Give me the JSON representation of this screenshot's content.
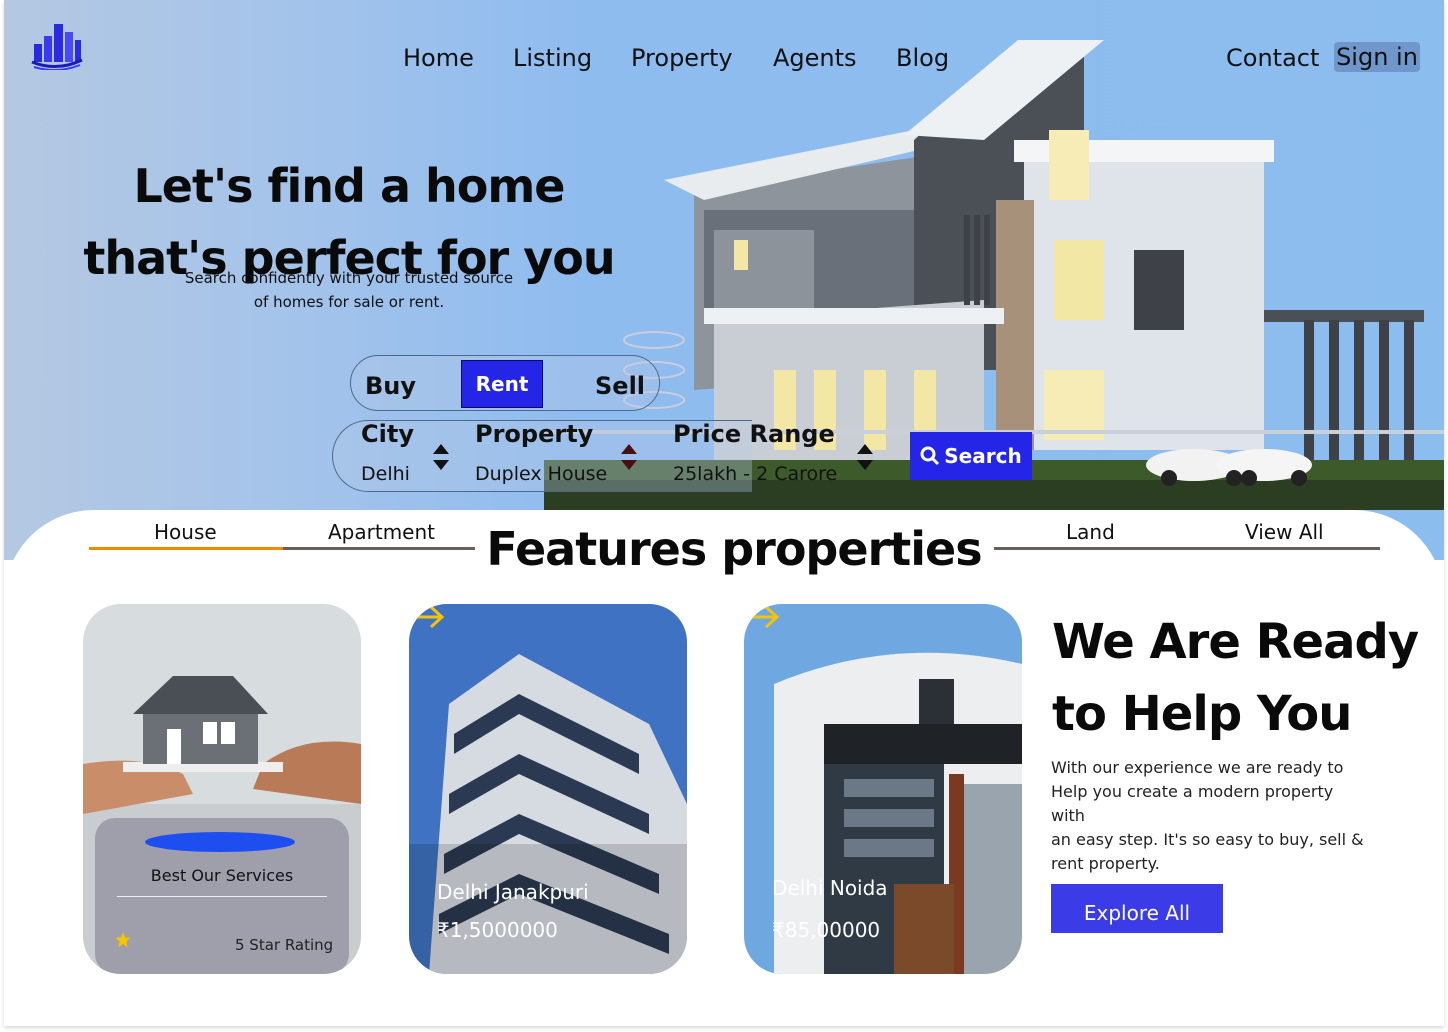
{
  "nav": {
    "items": [
      "Home",
      "Listing",
      "Property",
      "Agents",
      "Blog"
    ],
    "contact": "Contact",
    "signin": "Sign in"
  },
  "hero": {
    "headline_line1": "Let's find a home",
    "headline_line2": "that's perfect for you",
    "sub_line1": "Search confidently with your trusted source",
    "sub_line2": "of homes for sale or rent."
  },
  "search": {
    "tabs": {
      "buy": "Buy",
      "rent": "Rent",
      "sell": "Sell",
      "active": "Rent"
    },
    "city_label": "City",
    "city_value": "Delhi",
    "property_label": "Property",
    "property_value": "Duplex House",
    "price_label": "Price Range",
    "price_value": "25lakh - 2 Carore",
    "button": "Search"
  },
  "features": {
    "title": "Features properties",
    "categories": [
      "House",
      "Apartment",
      "Land",
      "View All"
    ],
    "active_category": "House",
    "accent_color": "#f08a00"
  },
  "cards": [
    {
      "title": "Best Our Services",
      "stars": 5,
      "rating_text": "5 Star Rating"
    },
    {
      "name": "Delhi Janakpuri",
      "price": "₹1,5000000"
    },
    {
      "name": "Delhi Noida",
      "price": "₹85,00000"
    }
  ],
  "ready": {
    "title_line1": "We Are Ready",
    "title_line2": "to Help You",
    "p1": "With our experience we are ready to",
    "p2": "Help you create a modern property",
    "p3": "with",
    "p4": "an easy step. It's so easy to buy, sell &",
    "p5": "rent property.",
    "button": "Explore All"
  },
  "colors": {
    "brand_blue": "#2525e8",
    "hero_bg": "#8bbdee",
    "arrow_yellow": "#f5c400",
    "star_yellow": "#f5c400"
  },
  "icons": [
    "buildings-logo-icon",
    "sort-arrows-icon",
    "search-icon",
    "arrow-right-icon",
    "star-icon"
  ]
}
